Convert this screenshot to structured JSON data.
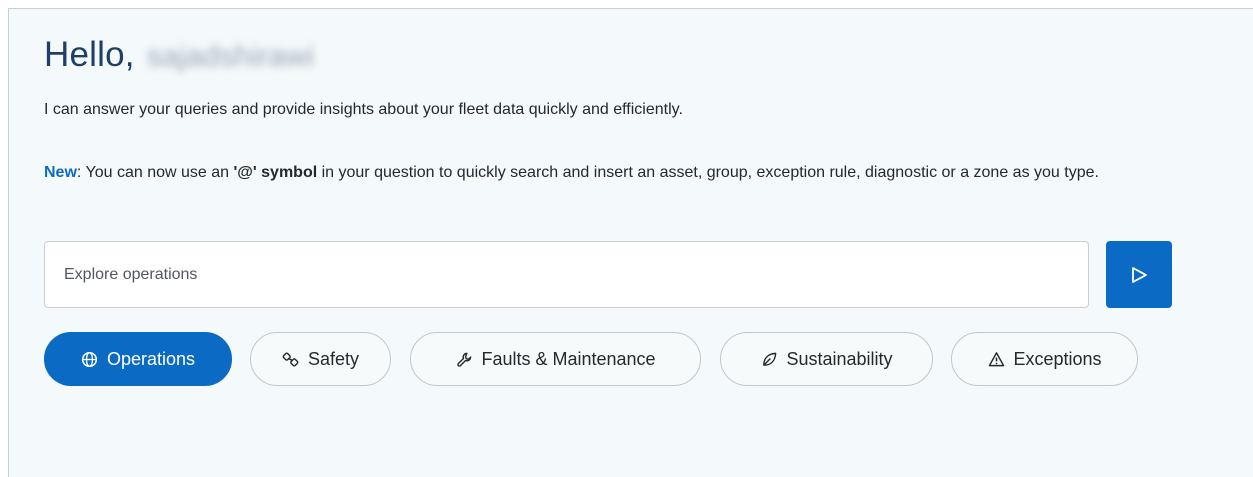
{
  "greeting": {
    "hello": "Hello,",
    "username": "sajadshirawi"
  },
  "intro_text": "I can answer your queries and provide insights about your fleet data quickly and efficiently.",
  "announcement": {
    "new_label": "New",
    "text_before": ": You can now use an ",
    "symbol_text": "'@' symbol",
    "text_after": " in your question to quickly search and insert an asset, group, exception rule, diagnostic or a zone as you type."
  },
  "search": {
    "placeholder": "Explore operations",
    "value": ""
  },
  "send_button": {
    "icon": "send-icon"
  },
  "chips": [
    {
      "label": "Operations",
      "icon": "globe-icon",
      "active": true
    },
    {
      "label": "Safety",
      "icon": "seatbelt-icon",
      "active": false
    },
    {
      "label": "Faults & Maintenance",
      "icon": "wrench-icon",
      "active": false
    },
    {
      "label": "Sustainability",
      "icon": "leaf-icon",
      "active": false
    },
    {
      "label": "Exceptions",
      "icon": "warning-icon",
      "active": false
    }
  ],
  "colors": {
    "accent": "#0b6bc4",
    "title": "#1f3f66",
    "panel_background": "#f4f9fb"
  }
}
